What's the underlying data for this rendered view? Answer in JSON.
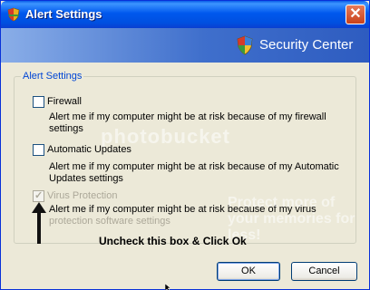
{
  "window": {
    "title": "Alert Settings",
    "close_icon": "close-icon"
  },
  "banner": {
    "title": "Security Center",
    "icon": "shield-icon"
  },
  "group": {
    "legend": "Alert Settings"
  },
  "options": [
    {
      "label": "Firewall",
      "description_line1": "Alert me if my computer might be at risk because of my firewall",
      "description_line2": "settings",
      "checked": false,
      "disabled": false
    },
    {
      "label": "Automatic Updates",
      "description_line1": "Alert me if my computer might be at risk because of my Automatic",
      "description_line2": "Updates settings",
      "checked": false,
      "disabled": false
    },
    {
      "label": "Virus Protection",
      "description_line1": "Alert me if my computer might be at risk because of my virus",
      "description_line2": "protection software settings",
      "checked": true,
      "disabled": true
    }
  ],
  "annotation": {
    "text": "Uncheck this box & Click Ok"
  },
  "watermark": {
    "text": "photobucket",
    "text2": "Protect more of your memories for less!"
  },
  "buttons": {
    "ok": "OK",
    "cancel": "Cancel"
  },
  "colors": {
    "title_blue": "#0058ee",
    "banner_blue": "#3f6fcc",
    "legend_blue": "#0046d5",
    "disabled_gray": "#aca899"
  }
}
